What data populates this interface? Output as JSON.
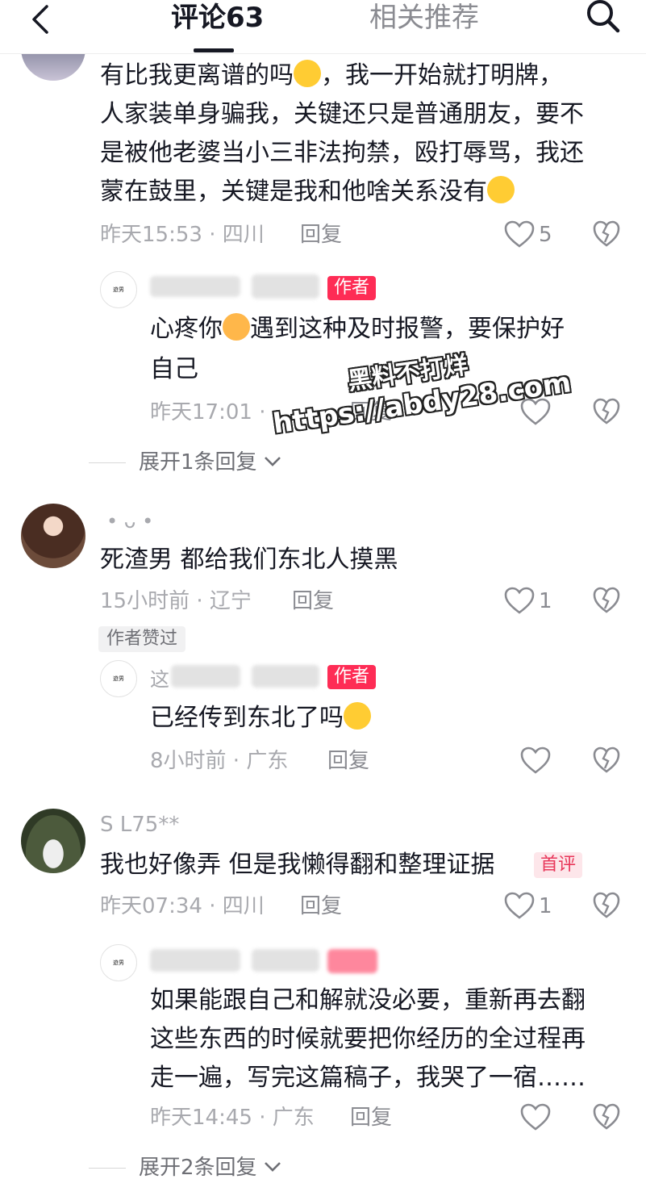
{
  "header": {
    "comments_tab": "评论63",
    "related_tab": "相关推荐"
  },
  "comments": [
    {
      "text_lines": [
        "有比我更离谱的吗",
        "，我一开始就打明牌，",
        "人家装单身骗我，关键还只是普通朋友，要不",
        "是被他老婆当小三非法拘禁，殴打辱骂，我还",
        "蒙在鼓里，关键是我和他啥关系没有"
      ],
      "time": "昨天15:53 · 四川",
      "reply_label": "回复",
      "likes": "5",
      "author_reply": {
        "avatar_text": "遊男",
        "badge": "作者",
        "text_lines": [
          "心疼你",
          "遇到这种及时报警，要保护好",
          "自己"
        ],
        "time": "昨天17:01 ·",
        "reply_label": "回复"
      },
      "expand_label": "展开1条回复"
    },
    {
      "username": "• ᴗ •",
      "text": "死渣男 都给我们东北人摸黑",
      "time": "15小时前 · 辽宁",
      "reply_label": "回复",
      "likes": "1",
      "tag": "作者赞过",
      "author_reply": {
        "avatar_text": "遊男",
        "username_prefix": "这",
        "badge": "作者",
        "text": "已经传到东北了吗",
        "time": "8小时前 · 广东",
        "reply_label": "回复"
      }
    },
    {
      "username": "S L75**",
      "text": "我也好像弄 但是我懒得翻和整理证据",
      "first_badge": "首评",
      "time": "昨天07:34 · 四川",
      "reply_label": "回复",
      "likes": "1",
      "author_reply": {
        "avatar_text": "遊男",
        "text_lines": [
          "如果能跟自己和解就没必要，重新再去翻",
          "这些东西的时候就要把你经历的全过程再",
          "走一遍，写完这篇稿子，我哭了一宿……"
        ],
        "time": "昨天14:45 · 广东",
        "reply_label": "回复"
      },
      "expand_label": "展开2条回复"
    }
  ],
  "watermark": {
    "line1": "黑料不打烊",
    "line2": "https://abdy28.com"
  },
  "colors": {
    "accent": "#fe2c55",
    "text": "#161823",
    "meta": "#a8a9ae"
  },
  "icons": [
    "back-icon",
    "search-icon",
    "heart-icon",
    "broken-heart-icon",
    "chevron-down-icon"
  ]
}
